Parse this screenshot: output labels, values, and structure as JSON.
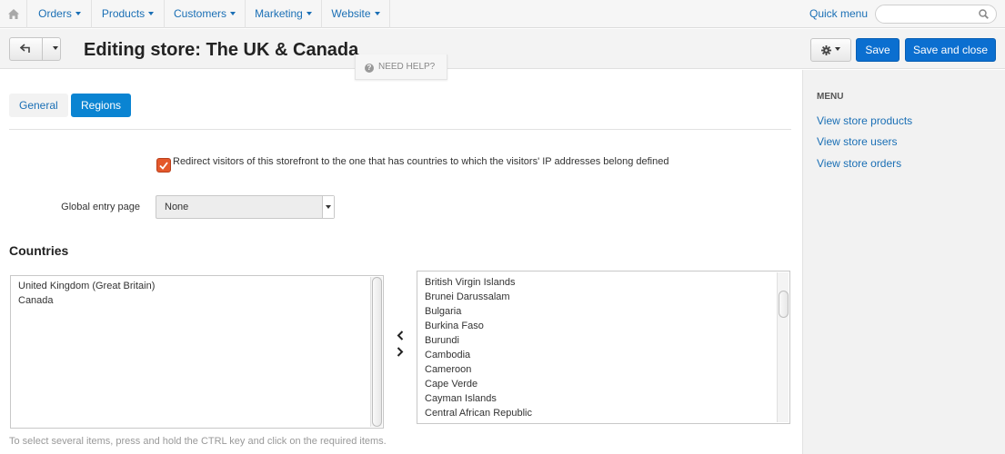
{
  "topnav": {
    "items": [
      {
        "label": "Orders"
      },
      {
        "label": "Products"
      },
      {
        "label": "Customers"
      },
      {
        "label": "Marketing"
      },
      {
        "label": "Website"
      }
    ],
    "quick_menu": "Quick menu",
    "search": {
      "placeholder": "",
      "value": ""
    }
  },
  "header": {
    "title": "Editing store: The UK & Canada",
    "help": "NEED HELP?",
    "save_label": "Save",
    "save_close_label": "Save and close"
  },
  "tabs": [
    {
      "label": "General",
      "active": false
    },
    {
      "label": "Regions",
      "active": true
    }
  ],
  "form": {
    "redirect_label": "Redirect visitors of this storefront to the one that has countries to which the visitors' IP addresses belong defined",
    "redirect_checked": true,
    "entry_label": "Global entry page",
    "entry_value": "None"
  },
  "countries": {
    "title": "Countries",
    "selected": [
      "United Kingdom (Great Britain)",
      "Canada"
    ],
    "available": [
      "British Virgin Islands",
      "Brunei Darussalam",
      "Bulgaria",
      "Burkina Faso",
      "Burundi",
      "Cambodia",
      "Cameroon",
      "Cape Verde",
      "Cayman Islands",
      "Central African Republic"
    ],
    "hint": "To select several items, press and hold the CTRL key and click on the required items."
  },
  "sidebar": {
    "title": "MENU",
    "links": [
      {
        "label": "View store products"
      },
      {
        "label": "View store users"
      },
      {
        "label": "View store orders"
      }
    ]
  },
  "colors": {
    "primary": "#0b6fd0",
    "link": "#1a6fb5",
    "active_tab": "#0a84d2",
    "checkbox": "#e4582b"
  }
}
